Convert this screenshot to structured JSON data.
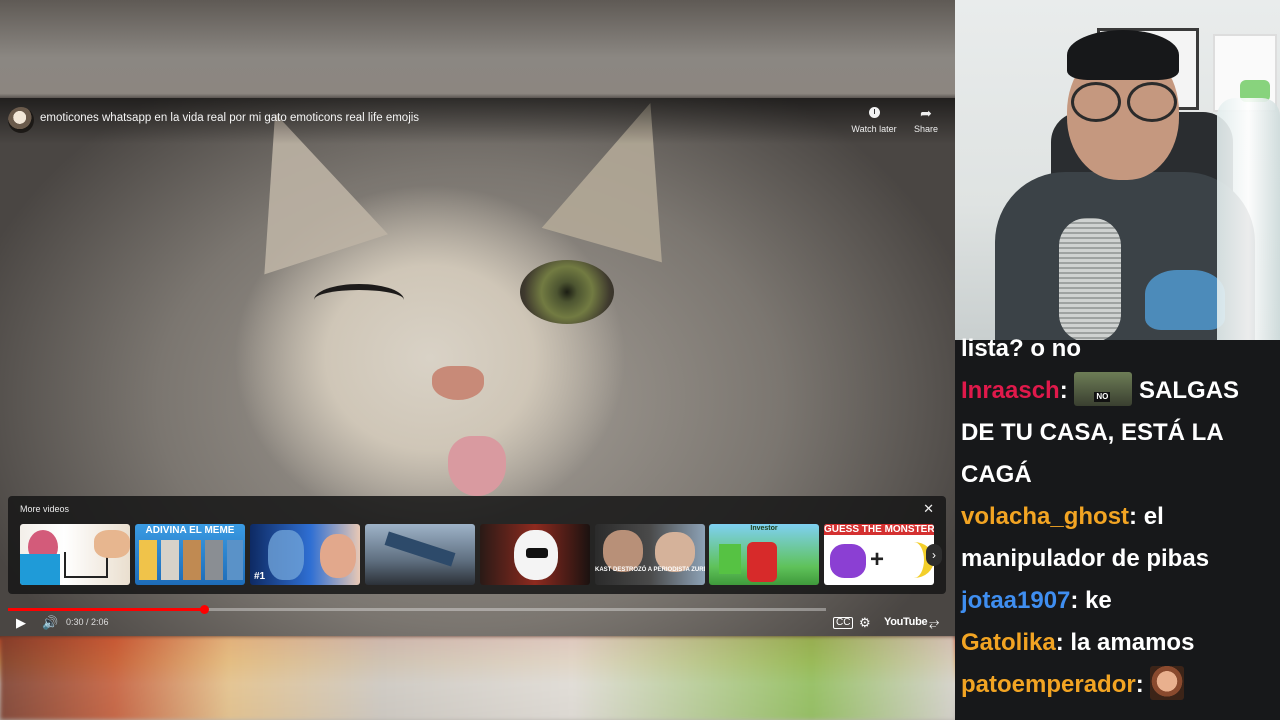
{
  "player": {
    "video_title": "emoticones whatsapp en la vida real por mi gato emoticons real life emojis",
    "watch_later_label": "Watch later",
    "share_label": "Share",
    "more_videos_label": "More videos",
    "time_display": "0:30 / 2:06",
    "logo_text": "YouTube",
    "progress_fraction": 0.24,
    "thumbnails": [
      {
        "caption": ""
      },
      {
        "caption": "ADIVINA EL MEME"
      },
      {
        "caption": "#1"
      },
      {
        "caption": ""
      },
      {
        "caption": ""
      },
      {
        "caption": "KAST DESTROZÓ A PERIODISTA ZURDO QUE LLORABA POR SU VICTORIA"
      },
      {
        "caption": "Investor"
      },
      {
        "caption": "GUESS THE MONSTER"
      }
    ]
  },
  "chat": {
    "lines": [
      {
        "user": "",
        "user_color": "",
        "text": "lista? o no"
      },
      {
        "user": "Inraasch",
        "user_color": "#e0194b",
        "emote": "NO",
        "text": " SALGAS"
      },
      {
        "user": "",
        "user_color": "",
        "text": "DE TU CASA, ESTÁ LA"
      },
      {
        "user": "",
        "user_color": "",
        "text": "CAGÁ"
      },
      {
        "user": "volacha_ghost",
        "user_color": "#f2a423",
        "text": " el"
      },
      {
        "user": "",
        "user_color": "",
        "text": "manipulador de pibas"
      },
      {
        "user": "jotaa1907",
        "user_color": "#3f8ef0",
        "text": " ke"
      },
      {
        "user": "Gatolika",
        "user_color": "#f2a423",
        "text": " la amamos"
      },
      {
        "user": "patoemperador",
        "user_color": "#f2a423",
        "text": " "
      }
    ]
  },
  "colors": {
    "accent_red": "#ff0000",
    "chat_bg": "#17181a"
  }
}
